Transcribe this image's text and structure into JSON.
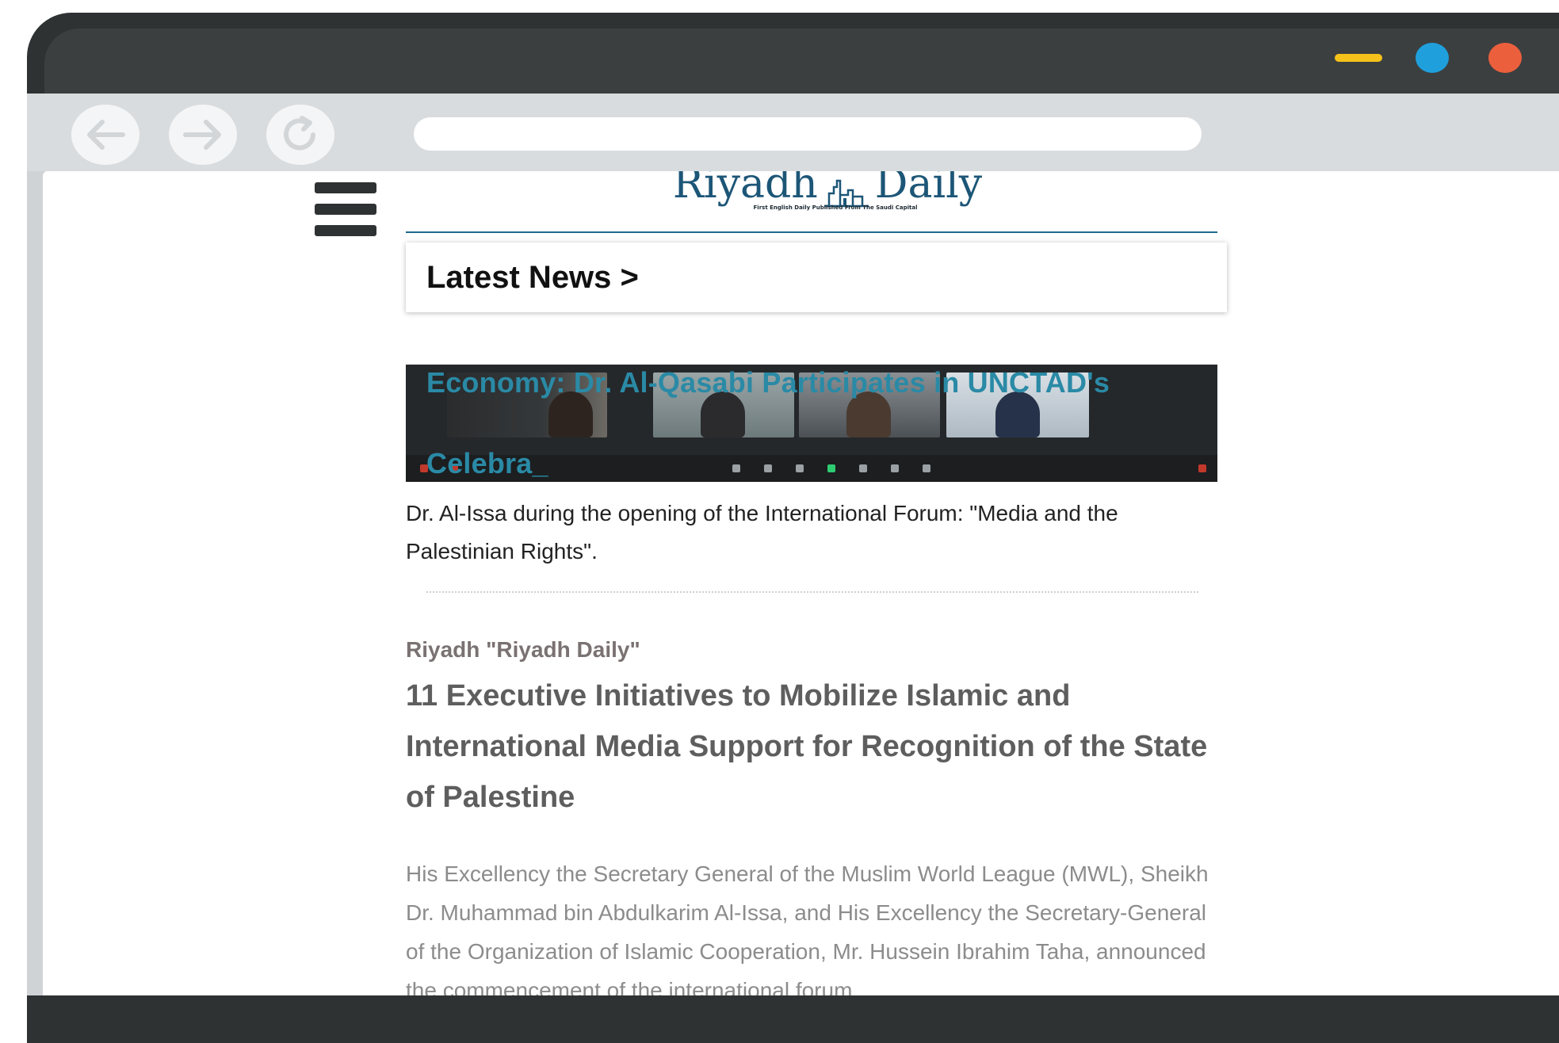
{
  "window": {
    "accent_min": "#f4c21a",
    "accent_max": "#1fa0dc",
    "accent_close": "#ec5f3d"
  },
  "browser": {
    "back_icon": "arrow-left-icon",
    "forward_icon": "arrow-right-icon",
    "reload_icon": "reload-icon",
    "url": ""
  },
  "site": {
    "logo_left": "Riyadh",
    "logo_right": "Daily",
    "tagline": "First English Daily Published From The Saudi Capital",
    "menu_icon": "hamburger-menu-icon"
  },
  "latest": {
    "title": "Latest News >"
  },
  "ticker": {
    "line1": "Economy: Dr. Al-Qasabi Participates in UNCTAD's",
    "line2": "Celebra_"
  },
  "article": {
    "caption": "Dr. Al-Issa during the opening of the International Forum: \"Media and the Palestinian Rights\".",
    "byline": "Riyadh \"Riyadh Daily\"",
    "headline": "11 Executive Initiatives to Mobilize Islamic and International Media Support for Recognition of the State of Palestine",
    "body": "His Excellency the Secretary General of the Muslim World League (MWL), Sheikh Dr. Muhammad bin Abdulkarim Al-Issa, and His Excellency the Secretary-General of the Organization of Islamic Cooperation, Mr. Hussein Ibrahim Taha, announced the commencement of the international forum"
  },
  "colors": {
    "brand": "#1c5677",
    "ticker": "#2a8aa6",
    "headline": "#5e5e5e"
  }
}
